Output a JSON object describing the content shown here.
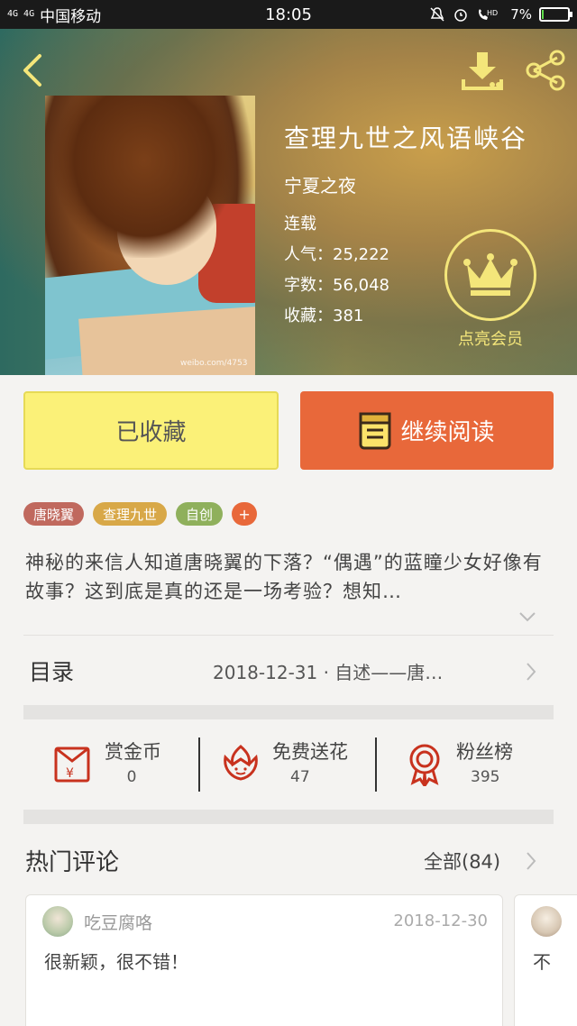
{
  "status_bar": {
    "signal": "4G 4G",
    "carrier": "中国移动",
    "time": "18:05",
    "battery": "7%",
    "battery_fraction": 0.07
  },
  "book": {
    "title": "查理九世之风语峡谷",
    "author": "宁夏之夜",
    "status": "连载",
    "popularity": "人气：25,222",
    "word_count": "字数：56,048",
    "favorites": "收藏：381",
    "cover_watermark": "weibo.com/4753",
    "vip_label": "点亮会员"
  },
  "actions": {
    "collected_label": "已收藏",
    "continue_label": "继续阅读"
  },
  "tags": [
    {
      "label": "唐晓翼",
      "color": "#c0695e"
    },
    {
      "label": "查理九世",
      "color": "#d8a848"
    },
    {
      "label": "自创",
      "color": "#8fb05c"
    },
    {
      "label": "+",
      "color": "#e8683a"
    }
  ],
  "description": "神秘的来信人知道唐晓翼的下落？“偶遇”的蓝瞳少女好像有故事？这到底是真的还是一场考验？想知…",
  "toc": {
    "label": "目录",
    "latest": "2018-12-31 · 自述——唐…"
  },
  "stats": {
    "reward": {
      "label": "赏金币",
      "value": "0"
    },
    "flower": {
      "label": "免费送花",
      "value": "47"
    },
    "fans": {
      "label": "粉丝榜",
      "value": "395"
    }
  },
  "hot_comments": {
    "label": "热门评论",
    "all_label": "全部(84)",
    "items": [
      {
        "user": "吃豆腐咯",
        "date": "2018-12-30",
        "text": "很新颖，很不错！"
      },
      {
        "text": "不"
      }
    ]
  },
  "colors": {
    "accent_orange": "#e8683a",
    "collect_yellow": "#fbf178",
    "vip_gold": "#f4e67a"
  },
  "icons": [
    "back-icon",
    "download-icon",
    "share-icon",
    "crown-icon",
    "book-icon",
    "red-envelope-icon",
    "flower-icon",
    "medal-icon",
    "chevron-down-icon",
    "chevron-right-icon"
  ]
}
